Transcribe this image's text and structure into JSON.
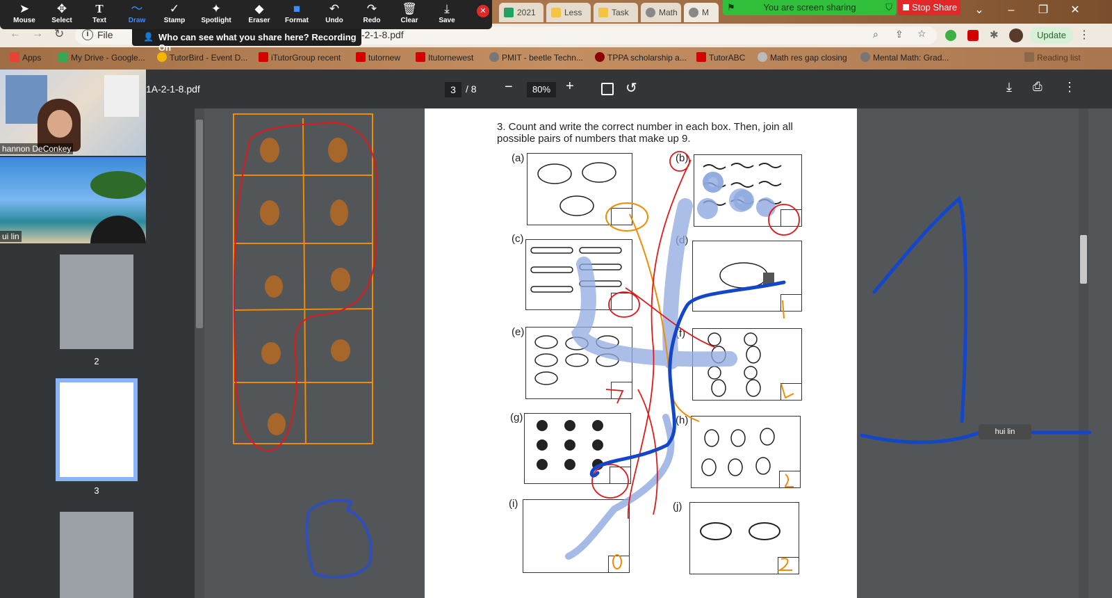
{
  "browser": {
    "tabs": [
      {
        "label": "2021",
        "color": "#1ea362"
      },
      {
        "label": "Less",
        "color": "#f4c542"
      },
      {
        "label": "Task",
        "color": "#f4c542"
      },
      {
        "label": "Math",
        "color": "#888"
      },
      {
        "label": "M",
        "color": "#888"
      }
    ],
    "url_prefix": "File",
    "url": "-2-1-8.pdf",
    "update_label": "Update",
    "bookmarks": [
      {
        "label": "Apps",
        "color": "#e94235"
      },
      {
        "label": "My Drive - Google...",
        "color": "#34a853"
      },
      {
        "label": "TutorBird - Event D...",
        "color": "#f4b400"
      },
      {
        "label": "iTutorGroup recent",
        "color": "#d50000"
      },
      {
        "label": "tutornew",
        "color": "#d50000"
      },
      {
        "label": "Itutornewest",
        "color": "#d50000"
      },
      {
        "label": "PMIT - beetle Techn...",
        "color": "#777"
      },
      {
        "label": "TPPA scholarship a...",
        "color": "#8b0000"
      },
      {
        "label": "TutorABC",
        "color": "#d50000"
      },
      {
        "label": "Math res gap closing",
        "color": "#bbb"
      },
      {
        "label": "Mental Math: Grad...",
        "color": "#777"
      }
    ],
    "reading_list": "Reading list"
  },
  "zoom": {
    "tools": [
      {
        "label": "Mouse",
        "icon": "cursor-icon",
        "glyph": "➤"
      },
      {
        "label": "Select",
        "icon": "move-icon",
        "glyph": "✥"
      },
      {
        "label": "Text",
        "icon": "text-icon",
        "glyph": "T"
      },
      {
        "label": "Draw",
        "icon": "draw-icon",
        "glyph": "〜",
        "active": true
      },
      {
        "label": "Stamp",
        "icon": "stamp-icon",
        "glyph": "✓"
      },
      {
        "label": "Spotlight",
        "icon": "spotlight-icon",
        "glyph": "✦"
      },
      {
        "label": "Eraser",
        "icon": "eraser-icon",
        "glyph": "◆"
      },
      {
        "label": "Format",
        "icon": "format-icon",
        "glyph": "■"
      },
      {
        "label": "Undo",
        "icon": "undo-icon",
        "glyph": "↶"
      },
      {
        "label": "Redo",
        "icon": "redo-icon",
        "glyph": "↷"
      },
      {
        "label": "Clear",
        "icon": "trash-icon",
        "glyph": "🗑"
      },
      {
        "label": "Save",
        "icon": "save-icon",
        "glyph": "⤓"
      }
    ],
    "tooltip": "Who can see what you share here? Recording On",
    "share_status": "You are screen sharing",
    "stop_share": "Stop Share",
    "participants": [
      {
        "name": "hannon DeConkey"
      },
      {
        "name": "ui lin"
      }
    ],
    "cursor_name": "hui lin"
  },
  "pdf": {
    "filename": "1A-2-1-8.pdf",
    "page": "3",
    "total": "/ 8",
    "zoom": "80%",
    "thumb_labels": [
      "2",
      "3"
    ],
    "question": "3.  Count and write the correct number in each box. Then, join all possible pairs of numbers that make up 9.",
    "labels": [
      "(a)",
      "(b)",
      "(c)",
      "(d)",
      "(e)",
      "(f)",
      "(g)",
      "(h)",
      "(i)",
      "(j)"
    ]
  },
  "colors": {
    "accent": "#3a8cff",
    "share": "#2fbf3b",
    "stop": "#e02828",
    "annot_blue": "#1446c9",
    "annot_light": "#8fa9e0",
    "annot_orange": "#f08c00",
    "annot_red": "#e01818"
  }
}
